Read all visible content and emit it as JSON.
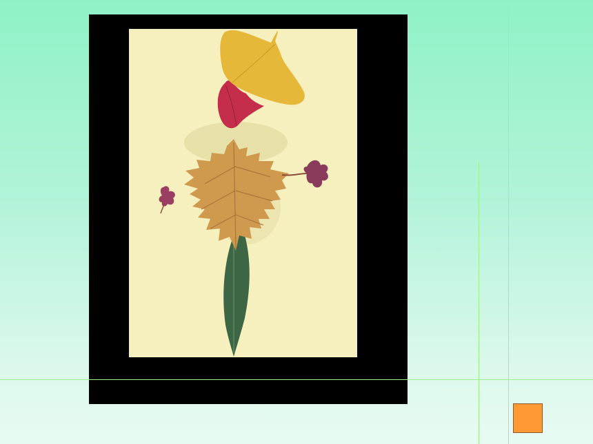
{
  "slide": {
    "background_top": "#8ff2c6",
    "background_bottom": "#e8fbf2",
    "guide_line_color": "#9ef08a"
  },
  "photo": {
    "frame_color": "#000000",
    "paper_color": "#f6f0bf",
    "subject": "leaf-collage-figure",
    "colors": {
      "ginkgo": "#e6b83a",
      "red_leaf": "#c42e4a",
      "brown_leaf": "#d09a4e",
      "green_leaf": "#3d6645",
      "purple_flower": "#8a3a5a"
    }
  },
  "nav_button": {
    "icon": "orange-square",
    "color": "#ff9933"
  }
}
